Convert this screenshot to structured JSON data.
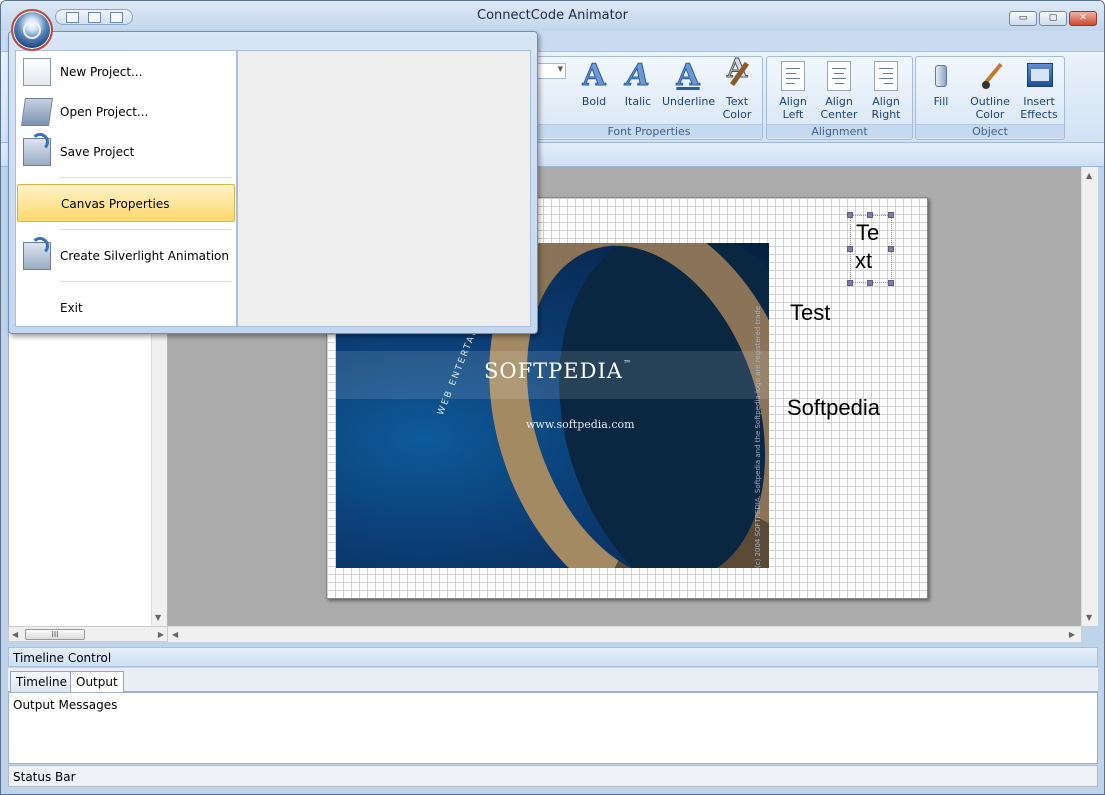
{
  "window": {
    "title": "ConnectCode Animator"
  },
  "window_controls": {
    "minimize": "▭",
    "restore": "▢",
    "close": "✕"
  },
  "ribbon": {
    "font_properties": {
      "label": "Font Properties",
      "buttons": [
        {
          "label_1": "Bold",
          "label_2": ""
        },
        {
          "label_1": "Italic",
          "label_2": ""
        },
        {
          "label_1": "Underline",
          "label_2": ""
        },
        {
          "label_1": "Text",
          "label_2": "Color"
        }
      ]
    },
    "alignment": {
      "label": "Alignment",
      "buttons": [
        {
          "label_1": "Align",
          "label_2": "Left"
        },
        {
          "label_1": "Align",
          "label_2": "Center"
        },
        {
          "label_1": "Align",
          "label_2": "Right"
        }
      ]
    },
    "object": {
      "label": "Object",
      "buttons": [
        {
          "label_1": "Fill",
          "label_2": ""
        },
        {
          "label_1": "Outline",
          "label_2": "Color"
        },
        {
          "label_1": "Insert",
          "label_2": "Effects"
        }
      ]
    }
  },
  "app_menu": {
    "items": [
      {
        "label": "New Project...",
        "icon": "new-document-icon"
      },
      {
        "label": "Open Project...",
        "icon": "open-folder-icon"
      },
      {
        "label": "Save Project",
        "icon": "save-icon"
      },
      {
        "label": "Canvas Properties",
        "icon": ""
      },
      {
        "label": "Create Silverlight Animation",
        "icon": "create-animation-icon"
      },
      {
        "label": "Exit",
        "icon": ""
      }
    ]
  },
  "canvas": {
    "texts": [
      {
        "line_1": "Te",
        "line_2": "xt"
      },
      {
        "line_1": "Test"
      },
      {
        "line_1": "Softpedia"
      }
    ],
    "image": {
      "logo": "SOFTPEDIA",
      "tm": "™",
      "url": "www.softpedia.com",
      "web": "WEB  ENTERTAINMENT",
      "vertical": "(c) 2004 SOFTPEDIA. Softpedia and the Softpedia logo are registered trade"
    }
  },
  "timeline": {
    "title": "Timeline Control",
    "tabs": [
      "Timeline",
      "Output"
    ],
    "active_tab": "Output",
    "output_text": "Output Messages"
  },
  "status_bar": {
    "text": "Status Bar"
  },
  "scroll": {
    "thumb_grip": "III"
  },
  "colors": {
    "accent": "#c3d7ee",
    "highlight": "#fdd86b"
  }
}
